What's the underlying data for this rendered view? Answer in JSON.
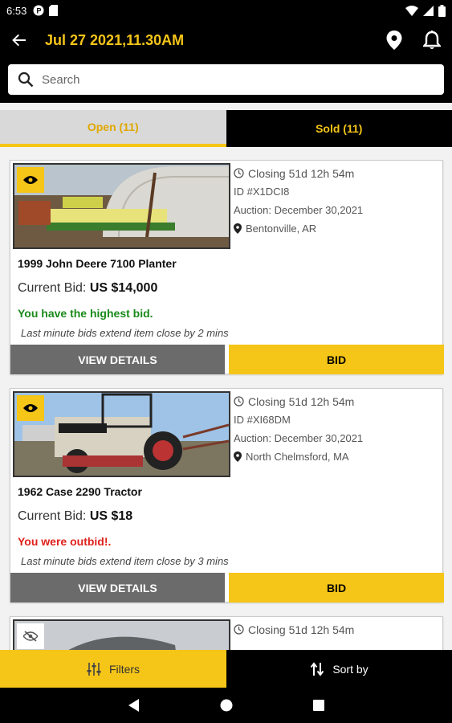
{
  "status_bar": {
    "time": "6:53"
  },
  "header": {
    "title": "Jul 27 2021,11.30AM"
  },
  "search": {
    "placeholder": "Search"
  },
  "tabs": [
    {
      "label": "Open (11)",
      "active": true
    },
    {
      "label": "Sold (11)",
      "active": false
    }
  ],
  "listings": [
    {
      "closing": "Closing 51d 12h 54m",
      "id": "ID #X1DCI8",
      "auction": "Auction: December 30,2021",
      "location": "Bentonville, AR",
      "name": "1999 John Deere 7100 Planter",
      "bid_label": "Current Bid:",
      "bid_amount": "US $14,000",
      "status": "You have the highest bid.",
      "status_color": "#1a8a1a",
      "note": "Last minute bids extend item close by 2 mins",
      "details_label": "VIEW DETAILS",
      "bid_button": "BID",
      "watched": true
    },
    {
      "closing": "Closing 51d 12h 54m",
      "id": "ID #XI68DM",
      "auction": "Auction: December 30,2021",
      "location": "North Chelmsford, MA",
      "name": "1962 Case 2290 Tractor",
      "bid_label": "Current Bid:",
      "bid_amount": "US $18",
      "status": "You were outbid!.",
      "status_color": "#e0201b",
      "note": "Last minute bids extend item close by 3 mins",
      "details_label": "VIEW DETAILS",
      "bid_button": "BID",
      "watched": true
    },
    {
      "closing": "Closing 51d 12h 54m",
      "watched": false
    }
  ],
  "bottom_bar": {
    "filters_label": "Filters",
    "sort_label": "Sort by"
  },
  "colors": {
    "accent": "#f5c518",
    "background": "#000000"
  }
}
